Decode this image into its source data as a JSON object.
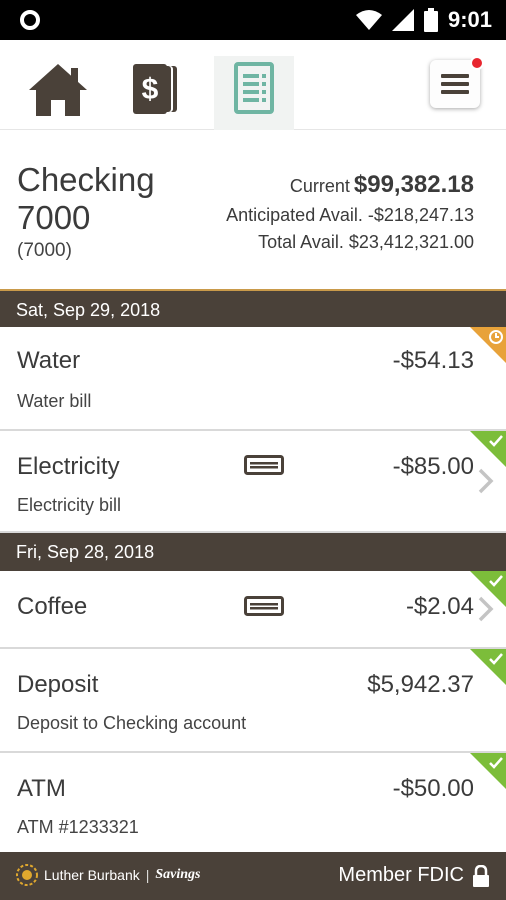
{
  "status_bar": {
    "time": "9:01"
  },
  "nav": {
    "tabs": [
      {
        "name": "home",
        "icon": "home-icon"
      },
      {
        "name": "money",
        "icon": "money-icon"
      },
      {
        "name": "register",
        "icon": "register-icon",
        "selected": true
      }
    ],
    "menu_icon": "hamburger-menu-icon",
    "notification_color": "#e8262f"
  },
  "account": {
    "name": "Checking 7000",
    "number": "(7000)",
    "current_label": "Current",
    "current_value": "$99,382.18",
    "anticipated": "Anticipated Avail. -$218,247.13",
    "total": "Total Avail. $23,412,321.00"
  },
  "groups": [
    {
      "date": "Sat, Sep 29, 2018",
      "transactions": [
        {
          "title": "Water",
          "amount": "-$54.13",
          "description": "Water bill",
          "status": "pending"
        },
        {
          "title": "Electricity",
          "amount": "-$85.00",
          "description": "Electricity bill",
          "status": "cleared",
          "card": true
        }
      ]
    },
    {
      "date": "Fri, Sep 28, 2018",
      "transactions": [
        {
          "title": "Coffee",
          "amount": "-$2.04",
          "status": "cleared",
          "card": true
        },
        {
          "title": "Deposit",
          "amount": "$5,942.37",
          "description": "Deposit to Checking account",
          "status": "cleared"
        },
        {
          "title": "ATM",
          "amount": "-$50.00",
          "description": "ATM #1233321",
          "status": "cleared"
        }
      ]
    }
  ],
  "footer": {
    "brand": "Luther Burbank",
    "brand_suffix": "Savings",
    "fdic": "Member FDIC"
  },
  "colors": {
    "header_bg": "#4a4139",
    "pending": "#e8a23a",
    "cleared": "#7cbd3a",
    "accent_teal": "#6fb5a3"
  }
}
